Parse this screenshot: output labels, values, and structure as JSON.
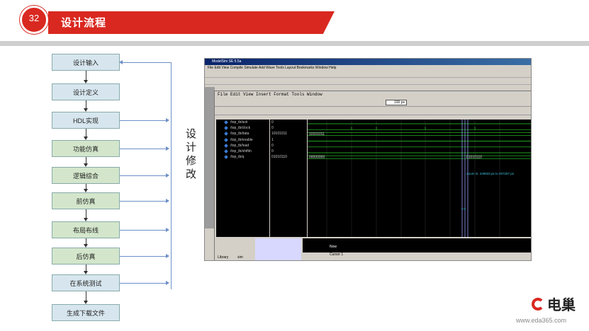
{
  "header": {
    "number": "32",
    "title": "设计流程"
  },
  "flow": [
    {
      "label": "设计输入",
      "style": "blue"
    },
    {
      "label": "设计定义",
      "style": "blue"
    },
    {
      "label": "HDL实现",
      "style": "blue"
    },
    {
      "label": "功能仿真",
      "style": "green"
    },
    {
      "label": "逻辑综合",
      "style": "green"
    },
    {
      "label": "前仿真",
      "style": "green"
    },
    {
      "label": "布局布线",
      "style": "green"
    },
    {
      "label": "后仿真",
      "style": "green"
    },
    {
      "label": "在系统测试",
      "style": "blue"
    },
    {
      "label": "生成下载文件",
      "style": "blue"
    }
  ],
  "side_text": "设计修改",
  "modelsim": {
    "title": "ModelSim SE 5.5a",
    "menu": "File  Edit  View  Compile  Simulate  Add  Wave  Tools  Layout  Bookmarks  Window  Help",
    "wave_menu": "File  Edit  View  Insert  Format  Tools  Window",
    "zoom": "100 ps",
    "signals": [
      "/top_tb/ack",
      "/top_tb/clock",
      "/top_tb/data",
      "/top_tb/enable",
      "/top_tb/load",
      "/top_tb/shiftin",
      "/top_tb/q"
    ],
    "values": [
      "0",
      "0",
      "10101011",
      "1",
      "0",
      "0",
      "01010110"
    ],
    "bus_labels": [
      "10101011",
      "00000000",
      "01010110"
    ],
    "zoom_note": "Zoom in: 249833 ps to 257257 ps",
    "cursor_label": "Cursor 1",
    "now_label": "Now",
    "tabs": [
      "Library",
      "sim"
    ],
    "transcript": "Transcript"
  },
  "brand": {
    "name": "电巢",
    "url": "www.eda365.com"
  }
}
